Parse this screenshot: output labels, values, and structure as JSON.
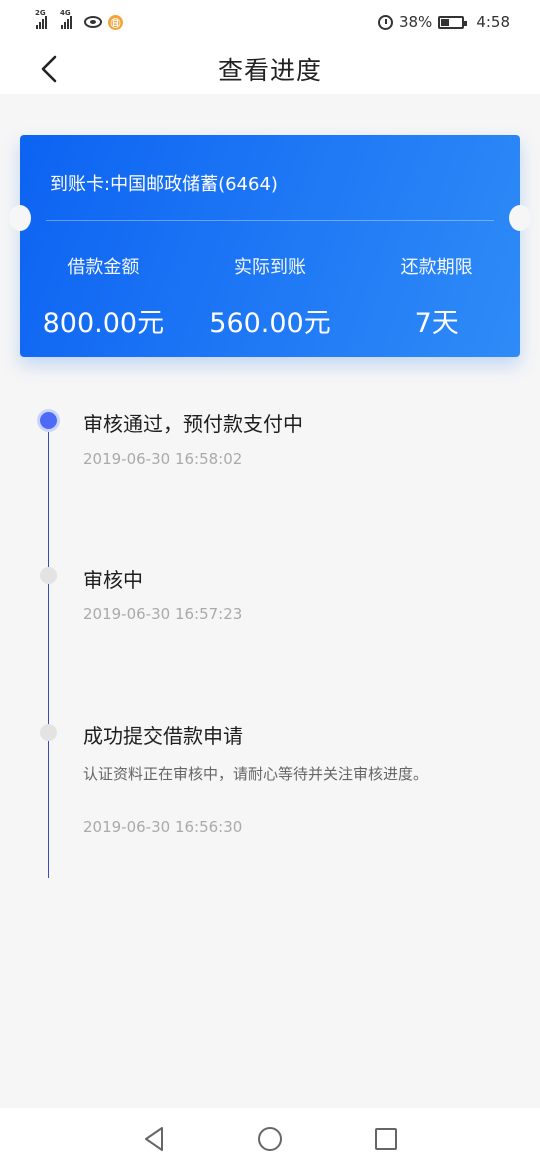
{
  "status_bar": {
    "sig1": "2G",
    "sig2": "4G",
    "coin": "㊐",
    "battery_pct_text": "38%",
    "battery_level": 0.38,
    "time": "4:58"
  },
  "nav": {
    "title": "查看进度"
  },
  "card": {
    "account": "到账卡:中国邮政储蓄(6464)",
    "columns": [
      {
        "label": "借款金额",
        "value": "800.00元"
      },
      {
        "label": "实际到账",
        "value": "560.00元"
      },
      {
        "label": "还款期限",
        "value": "7天"
      }
    ]
  },
  "timeline": {
    "items": [
      {
        "title": "审核通过，预付款支付中",
        "time": "2019-06-30 16:58:02"
      },
      {
        "title": "审核中",
        "time": "2019-06-30 16:57:23"
      },
      {
        "title": "成功提交借款申请",
        "desc": "认证资料正在审核中，请耐心等待并关注审核进度。",
        "time": "2019-06-30 16:56:30"
      }
    ]
  },
  "colors": {
    "card_start": "#0d63f2",
    "card_end": "#2f8bf7",
    "active_dot": "#4d6bf5",
    "timeline_line": "#3b4bb8"
  }
}
